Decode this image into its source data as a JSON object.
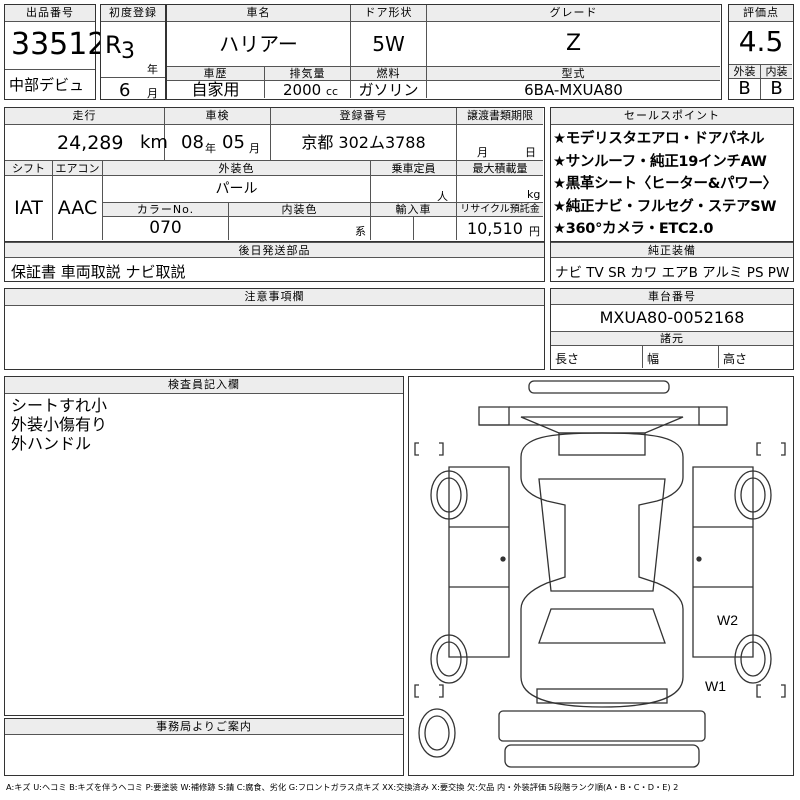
{
  "labels": {
    "lot_no": "出品番号",
    "first_reg": "初度登録",
    "car_name": "車名",
    "door": "ドア形状",
    "grade": "グレード",
    "score": "評価点",
    "history": "車歴",
    "displacement": "排気量",
    "fuel": "燃料",
    "model": "型式",
    "ext": "外装",
    "int": "内装",
    "mileage": "走行",
    "inspection": "車検",
    "reg_no": "登録番号",
    "transfer_deadline": "譲渡書類期限",
    "shift": "シフト",
    "aircon": "エアコン",
    "ext_color": "外装色",
    "capacity": "乗車定員",
    "max_load": "最大積載量",
    "color_no": "カラーNo.",
    "int_color": "内装色",
    "import": "輸入車",
    "recycle": "リサイクル預託金",
    "post_parts": "後日発送部品",
    "sales_points": "セールスポイント",
    "genuine": "純正装備",
    "notes": "注意事項欄",
    "chassis_no": "車台番号",
    "dimensions": "諸元",
    "length": "長さ",
    "width": "幅",
    "height": "高さ",
    "inspector": "検査員記入欄",
    "office": "事務局よりご案内",
    "year_unit": "年",
    "month_unit": "月",
    "day_unit": "日",
    "cc_unit": "cc",
    "km_unit": "km",
    "person_unit": "人",
    "kg_unit": "kg",
    "yen_unit": "円",
    "kei_unit": "系"
  },
  "values": {
    "lot_no": "33512",
    "debut": "中部デビュ",
    "era": "R",
    "year": "3",
    "month": "6",
    "car_name": "ハリアー",
    "door": "5W",
    "grade": "Z",
    "score": "4.5",
    "history": "自家用",
    "displacement": "2000",
    "fuel": "ガソリン",
    "model": "6BA-MXUA80",
    "ext_score": "B",
    "int_score": "B",
    "mileage": "24,289",
    "insp_year": "08",
    "insp_year_unit": "年",
    "insp_month": "05",
    "reg_no": "京都 302ム3788",
    "shift": "IAT",
    "aircon": "AAC",
    "ext_color": "パール",
    "color_no": "070",
    "recycle": "10,510",
    "post_parts": "保証書 車両取説 ナビ取説",
    "chassis_no": "MXUA80-0052168"
  },
  "sales_points": [
    "★モデリスタエアロ・ドアパネル",
    "★サンルーフ・純正19インチAW",
    "★黒革シート〈ヒーター&パワー〉",
    "★純正ナビ・フルセグ・ステアSW",
    "★360°カメラ・ETC2.0"
  ],
  "genuine_equipment": "ナビ TV SR カワ エアB アルミ PS PW",
  "inspector_notes": [
    "シートすれ小",
    "外装小傷有り",
    "外ハンドル"
  ],
  "diagram_marks": {
    "w2": "W2",
    "w1": "W1"
  },
  "legend": "A:キズ U:ヘコミ B:キズを伴うヘコミ P:要塗装 W:補修跡 S:錆 C:腐食、劣化 G:フロントガラス点キズ XX:交換済み X:要交換 欠:欠品 内・外装評価 5段階ランク順(A・B・C・D・E) 2"
}
